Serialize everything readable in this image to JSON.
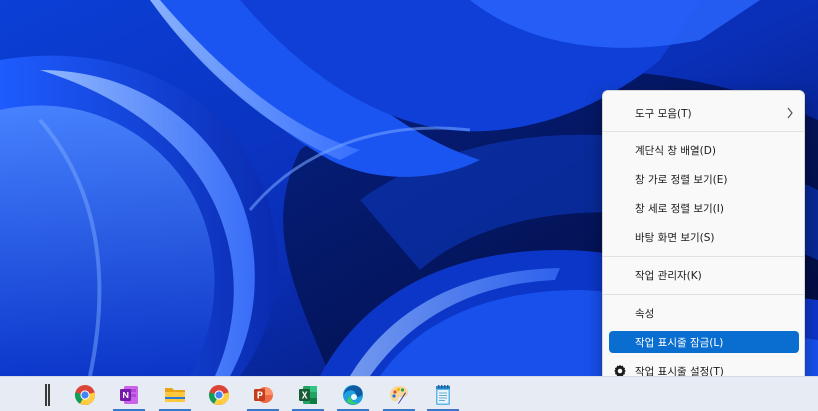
{
  "context_menu": {
    "items": [
      {
        "label": "도구 모음(T)"
      },
      {
        "label": "계단식 창 배열(D)"
      },
      {
        "label": "창 가로 정렬 보기(E)"
      },
      {
        "label": "창 세로 정렬 보기(I)"
      },
      {
        "label": "바탕 화면 보기(S)"
      },
      {
        "label": "작업 관리자(K)"
      },
      {
        "label": "속성"
      },
      {
        "label": "작업 표시줄 잠금(L)"
      },
      {
        "label": "작업 표시줄 설정(T)"
      }
    ],
    "highlighted_item": "작업 표시줄 잠금(L)",
    "submenu_icon": "chevron-right-icon",
    "settings_icon": "gear-icon"
  },
  "taskbar": {
    "apps": [
      {
        "name": "Google Chrome",
        "icon": "chrome-icon"
      },
      {
        "name": "OneNote",
        "icon": "onenote-icon"
      },
      {
        "name": "File Explorer",
        "icon": "folder-icon"
      },
      {
        "name": "Google Chrome",
        "icon": "chrome-icon"
      },
      {
        "name": "PowerPoint",
        "icon": "powerpoint-icon"
      },
      {
        "name": "Excel",
        "icon": "excel-icon"
      },
      {
        "name": "Microsoft Edge",
        "icon": "edge-icon"
      },
      {
        "name": "Paint",
        "icon": "paint-icon"
      },
      {
        "name": "Notepad",
        "icon": "notepad-icon"
      }
    ]
  },
  "colors": {
    "menu_highlight": "#0a6ed1",
    "taskbar_bg": "#e7ebf3",
    "wallpaper_base": "#0a2a9a"
  }
}
